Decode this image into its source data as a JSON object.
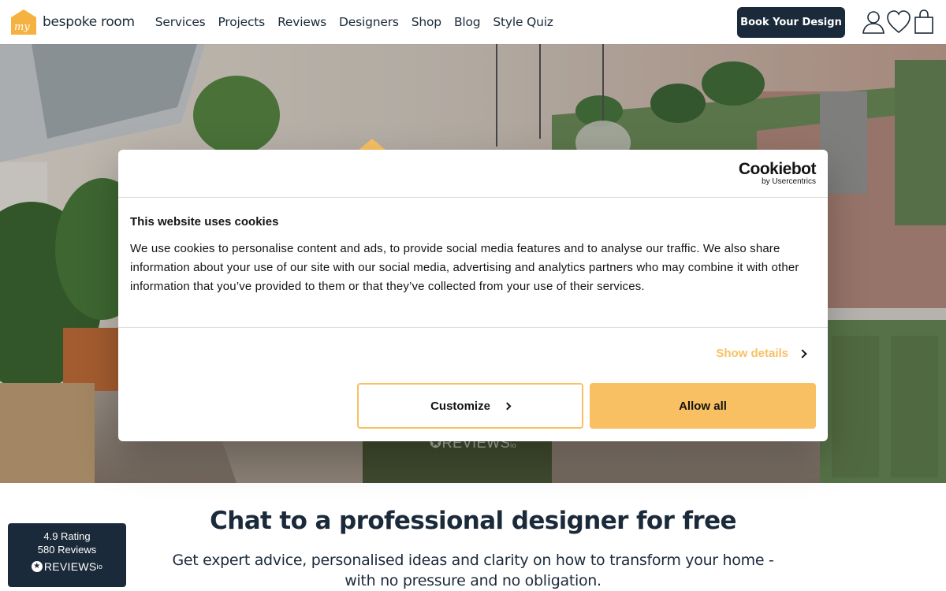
{
  "header": {
    "logo_badge": "my",
    "logo_text": "bespoke room",
    "nav": [
      "Services",
      "Projects",
      "Reviews",
      "Designers",
      "Shop",
      "Blog",
      "Style Quiz"
    ],
    "cta_label": "Book Your Design",
    "icons": [
      "user-icon",
      "heart-icon",
      "shopping-bag-icon"
    ]
  },
  "hero": {
    "reviews_watermark": "REVIEWS",
    "reviews_watermark_suffix": "io"
  },
  "cookie_dialog": {
    "brand": "Cookiebot",
    "brand_sub": "by Usercentrics",
    "title": "This website uses cookies",
    "body": "We use cookies to personalise content and ads, to provide social media features and to analyse our traffic. We also share information about your use of our site with our social media, advertising and analytics partners who may combine it with other information that you’ve provided to them or that they’ve collected from your use of their services.",
    "show_details": "Show details",
    "customize": "Customize",
    "allow_all": "Allow all"
  },
  "main": {
    "title": "Chat to a professional designer for free",
    "subtitle": "Get expert advice, personalised ideas and clarity on how to transform your home - with no pressure and no obligation."
  },
  "rating_widget": {
    "rating": "4.9 Rating",
    "reviews": "580 Reviews",
    "brand": "REVIEWS",
    "brand_suffix": "io"
  },
  "colors": {
    "navy": "#1b2a3a",
    "accent": "#f8c063",
    "logo_orange": "#f5b240",
    "cabinet_green": "#6f8f5c"
  }
}
